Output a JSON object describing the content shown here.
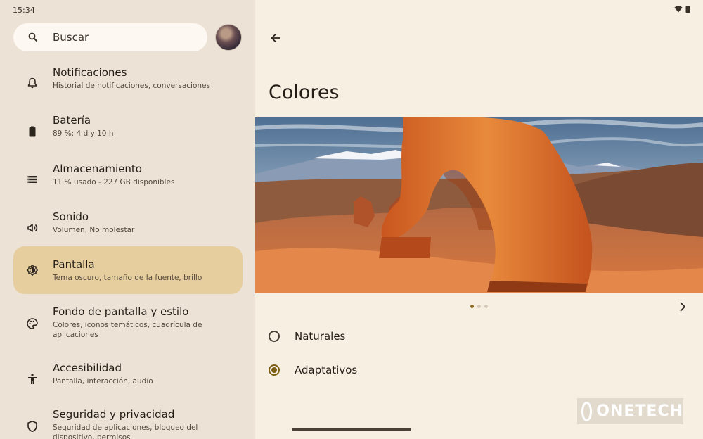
{
  "status_bar": {
    "time": "15:34",
    "icons": [
      "wifi-icon",
      "battery-icon"
    ]
  },
  "search": {
    "placeholder": "Buscar"
  },
  "settings_items": [
    {
      "icon": "bell-icon",
      "title": "Notificaciones",
      "subtitle": "Historial de notificaciones, conversaciones",
      "selected": false
    },
    {
      "icon": "battery-icon",
      "title": "Batería",
      "subtitle": "89 %: 4 d y 10 h",
      "selected": false
    },
    {
      "icon": "storage-icon",
      "title": "Almacenamiento",
      "subtitle": "11 % usado - 227 GB disponibles",
      "selected": false
    },
    {
      "icon": "sound-icon",
      "title": "Sonido",
      "subtitle": "Volumen, No molestar",
      "selected": false
    },
    {
      "icon": "brightness-icon",
      "title": "Pantalla",
      "subtitle": "Tema oscuro, tamaño de la fuente, brillo",
      "selected": true
    },
    {
      "icon": "palette-icon",
      "title": "Fondo de pantalla y estilo",
      "subtitle": "Colores, iconos temáticos, cuadrícula de aplicaciones",
      "selected": false
    },
    {
      "icon": "accessibility-icon",
      "title": "Accesibilidad",
      "subtitle": "Pantalla, interacción, audio",
      "selected": false
    },
    {
      "icon": "shield-icon",
      "title": "Seguridad y privacidad",
      "subtitle": "Seguridad de aplicaciones, bloqueo del dispositivo, permisos",
      "selected": false
    }
  ],
  "detail": {
    "title": "Colores",
    "carousel": {
      "page_count": 3,
      "current_page": 1
    },
    "options": [
      {
        "label": "Naturales",
        "selected": false
      },
      {
        "label": "Adaptativos",
        "selected": true
      }
    ]
  },
  "watermark": {
    "text": "ONETECH"
  },
  "colors": {
    "accent": "#7d5f14",
    "selected_bg": "#e6ce9f",
    "panel_bg": "#ece2d6",
    "detail_bg": "#f8efe3"
  }
}
